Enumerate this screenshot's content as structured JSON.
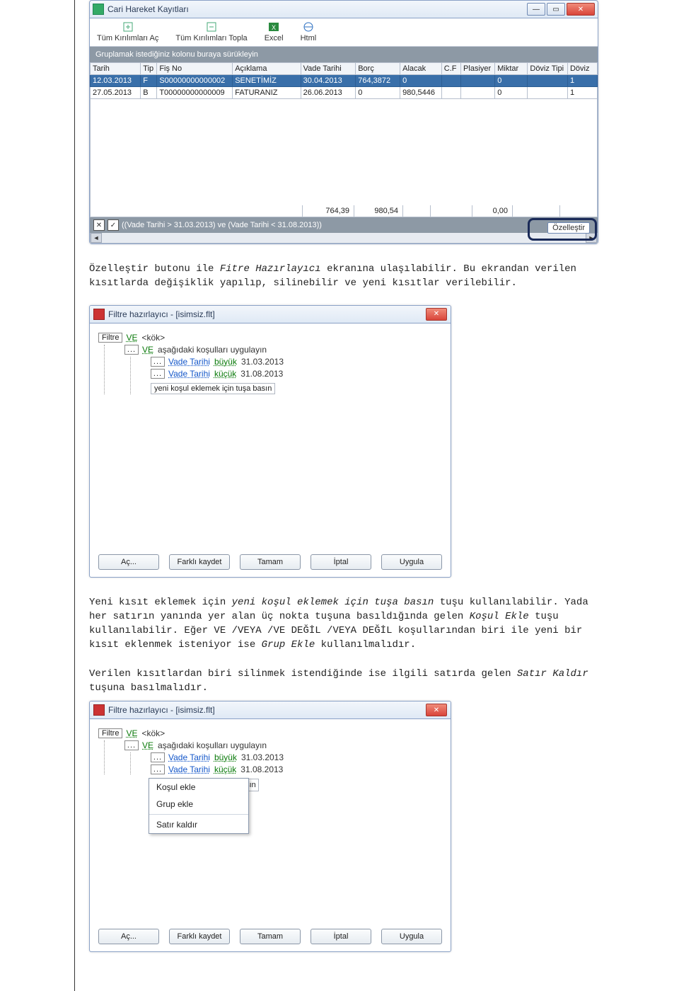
{
  "mainWindow": {
    "title": "Cari Hareket Kayıtları",
    "toolbar": [
      {
        "label": "Tüm Kırılımları Aç"
      },
      {
        "label": "Tüm Kırılımları Topla"
      },
      {
        "label": "Excel"
      },
      {
        "label": "Html"
      }
    ],
    "groupHint": "Gruplamak istediğiniz kolonu buraya sürükleyin",
    "columns": [
      "Tarih",
      "Tip",
      "Fiş No",
      "Açıklama",
      "Vade Tarihi",
      "Borç",
      "Alacak",
      "C.F",
      "Plasiyer",
      "Miktar",
      "Döviz Tipi",
      "Döviz"
    ],
    "rows": [
      {
        "tarih": "12.03.2013",
        "tip": "F",
        "fisno": "S00000000000002",
        "aciklama": "SENETİMİZ",
        "vade": "30.04.2013",
        "borc": "764,3872",
        "alacak": "0",
        "cf": "",
        "plasiyer": "",
        "miktar": "0",
        "dtipi": "",
        "doviz": "1",
        "sel": true
      },
      {
        "tarih": "27.05.2013",
        "tip": "B",
        "fisno": "T00000000000009",
        "aciklama": "FATURANIZ",
        "vade": "26.06.2013",
        "borc": "0",
        "alacak": "980,5446",
        "cf": "",
        "plasiyer": "",
        "miktar": "0",
        "dtipi": "",
        "doviz": "1",
        "sel": false
      }
    ],
    "sums": {
      "borc": "764,39",
      "alacak": "980,54",
      "miktar": "0,00"
    },
    "filterExpr": "((Vade Tarihi > 31.03.2013) ve (Vade Tarihi < 31.08.2013))",
    "customizeBtn": "Özelleştir"
  },
  "para1_a": "Özelleştir butonu ile ",
  "para1_i1": "Fitre Hazırlayıcı",
  "para1_b": " ekranına ulaşılabilir. Bu ekrandan verilen kısıtlarda değişiklik yapılıp, silinebilir ve yeni kısıtlar verilebilir.",
  "filterWin": {
    "title": "Filtre hazırlayıcı - [isimsiz.flt]",
    "rootBtn": "Filtre",
    "ve": "VE",
    "rootTail": "<kök>",
    "sub": "aşağıdaki koşulları uygulayın",
    "c1_field": "Vade Tarihi",
    "c1_op": "büyük",
    "c1_val": "31.03.2013",
    "c2_field": "Vade Tarihi",
    "c2_op": "küçük",
    "c2_val": "31.08.2013",
    "addHint": "yeni koşul eklemek için tuşa basın",
    "buttons": [
      "Aç...",
      "Farklı kaydet",
      "Tamam",
      "İptal",
      "Uygula"
    ]
  },
  "para2_a": "Yeni kısıt eklemek için ",
  "para2_i1": "yeni koşul eklemek için tuşa basın",
  "para2_b": " tuşu kullanılabilir. Yada her satırın yanında yer alan üç nokta tuşuna basıldığında gelen ",
  "para2_i2": "Koşul Ekle",
  "para2_c": " tuşu kullanılabilir. Eğer VE /VEYA /VE DEĞİL /VEYA DEĞİL koşullarından biri ile yeni bir kısıt eklenmek isteniyor ise ",
  "para2_i3": "Grup Ekle",
  "para2_d": " kullanılmalıdır.",
  "para3_a": "Verilen kısıtlardan biri silinmek istendiğinde ise ilgili satırda gelen ",
  "para3_i1": "Satır Kaldır",
  "para3_b": " tuşuna basılmalıdır.",
  "ctxMenu": {
    "items": [
      "Koşul ekle",
      "Grup ekle"
    ],
    "sepItem": "Satır kaldır",
    "hintBehind": "asın"
  }
}
